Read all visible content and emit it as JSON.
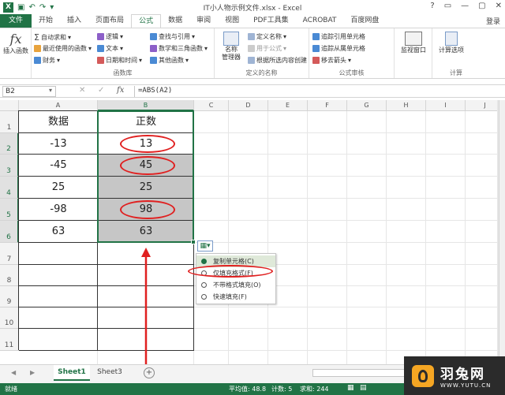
{
  "window": {
    "title": "IT小人物示例文件.xlsx - Excel",
    "controls": [
      "?",
      "▭",
      "—",
      "▢",
      "✕"
    ]
  },
  "quick_access": {
    "save_icon": "save-icon",
    "undo_icon": "undo-icon",
    "redo_icon": "redo-icon"
  },
  "tabs": [
    "文件",
    "开始",
    "插入",
    "页面布局",
    "公式",
    "数据",
    "审阅",
    "视图",
    "PDF工具集",
    "ACROBAT",
    "百度网盘"
  ],
  "active_tab": "公式",
  "login": "登录",
  "ribbon": {
    "insert_function": "插入函数",
    "library": {
      "autosum": "自动求和",
      "recent": "最近使用的函数",
      "financial": "财务",
      "logical": "逻辑",
      "text": "文本",
      "datetime": "日期和时间",
      "lookup": "查找与引用",
      "math": "数学和三角函数",
      "other": "其他函数",
      "label": "函数库"
    },
    "names": {
      "manager": "名称\n管理器",
      "define": "定义名称",
      "use_in_formula": "用于公式",
      "create_from_sel": "根据所选内容创建",
      "label": "定义的名称"
    },
    "audit": {
      "trace_precedents": "追踪引用单元格",
      "trace_dependents": "追踪从属单元格",
      "remove_arrows": "移去箭头",
      "label": "公式审核"
    },
    "watch": "监视窗口",
    "calc": {
      "options": "计算选项",
      "label": "计算"
    }
  },
  "formula_bar": {
    "name_box": "B2",
    "fx": "fx",
    "formula": "=ABS(A2)"
  },
  "columns": [
    "A",
    "B",
    "C",
    "D",
    "E",
    "F",
    "G",
    "H",
    "I",
    "J"
  ],
  "rows": [
    "1",
    "2",
    "3",
    "4",
    "5",
    "6",
    "7",
    "8",
    "9",
    "10",
    "11"
  ],
  "table": {
    "headers": [
      "数据",
      "正数"
    ],
    "rows": [
      [
        "-13",
        "13"
      ],
      [
        "-45",
        "45"
      ],
      [
        "25",
        "25"
      ],
      [
        "-98",
        "98"
      ],
      [
        "63",
        "63"
      ]
    ]
  },
  "autofill_menu": {
    "items": [
      "复制单元格(C)",
      "仅填充格式(F)",
      "不带格式填充(O)",
      "快速填充(F)"
    ],
    "selected": 0
  },
  "sheets": [
    "Sheet1",
    "Sheet3"
  ],
  "active_sheet": "Sheet1",
  "status": {
    "ready": "就绪",
    "average": "平均值: 48.8",
    "count": "计数: 5",
    "sum": "求和: 244"
  },
  "watermark": {
    "brand": "羽兔网",
    "url": "WWW.YUTU.CN"
  },
  "colors": {
    "excel_green": "#217346",
    "annotation_red": "#e02020",
    "selection_gray": "#c6c6c6"
  }
}
